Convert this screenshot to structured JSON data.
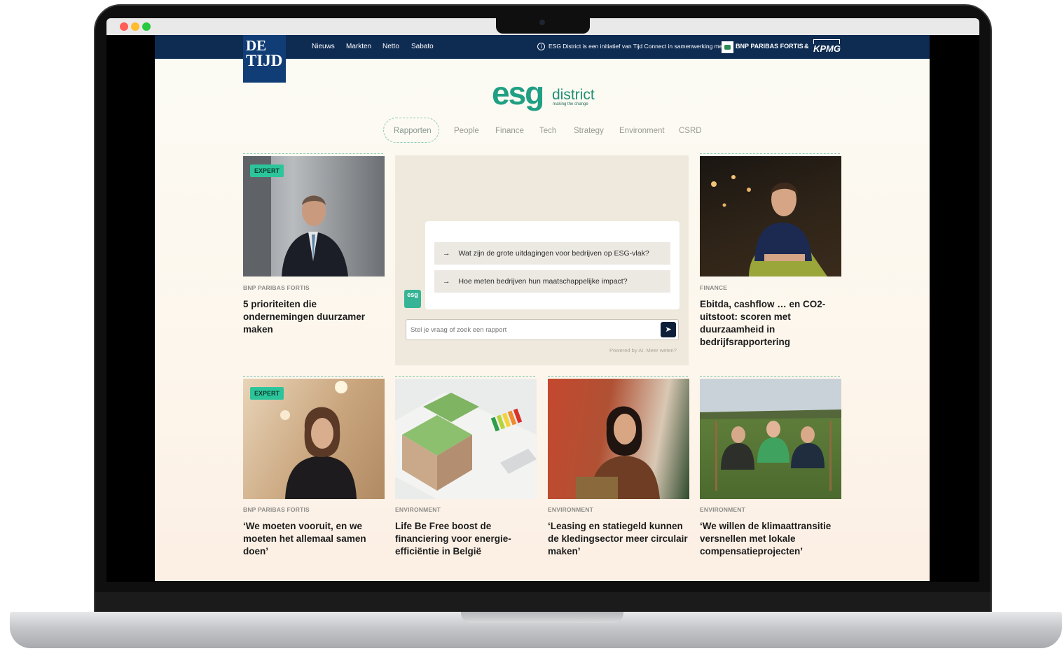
{
  "browser": {
    "traffic_colors": [
      "#ff5f57",
      "#febc2e",
      "#28c840"
    ]
  },
  "header": {
    "logo": {
      "line1": "DE",
      "line2": "TIJD"
    },
    "nav": [
      "Nieuws",
      "Markten",
      "Netto",
      "Sabato"
    ],
    "info_text": "ESG District is een initiatief van Tijd Connect in samenwerking met",
    "partner1": "BNP PARIBAS FORTIS",
    "ampersand": "&",
    "partner2": "KPMG"
  },
  "brand": {
    "logo_text": "esg",
    "word": "district",
    "tagline": "making the change",
    "color": "#1f9f83"
  },
  "categories": [
    "Rapporten",
    "People",
    "Finance",
    "Tech",
    "Strategy",
    "Environment",
    "CSRD"
  ],
  "active_category": "Rapporten",
  "ai": {
    "suggestions": [
      "Wat zijn de grote uitdagingen voor bedrijven op ESG-vlak?",
      "Hoe meten bedrijven hun maatschappelijke impact?"
    ],
    "mini_logo": "esg",
    "input_placeholder": "Stel je vraag of zoek een rapport",
    "powered_by": "Powered by AI. Meer weten?"
  },
  "articles": [
    {
      "badge": "EXPERT",
      "category": "BNP PARIBAS FORTIS",
      "title": "5 prioriteiten die ondernemingen duurzamer maken"
    },
    {
      "badge": "",
      "category": "FINANCE",
      "title": "Ebitda, cashflow … en CO2-uitstoot: scoren met duurzaamheid in bedrijfsrapportering"
    },
    {
      "badge": "EXPERT",
      "category": "BNP PARIBAS FORTIS",
      "title": "‘We moeten vooruit, en we moeten het allemaal samen doen’"
    },
    {
      "badge": "",
      "category": "ENVIRONMENT",
      "title": "Life Be Free boost de financiering voor energie-efficiëntie in België"
    },
    {
      "badge": "",
      "category": "ENVIRONMENT",
      "title": "‘Leasing en statiegeld kunnen de kledingsector meer circulair maken’"
    },
    {
      "badge": "",
      "category": "ENVIRONMENT",
      "title": "‘We willen de klimaattransitie versnellen met lokale compensatieprojecten’"
    }
  ]
}
